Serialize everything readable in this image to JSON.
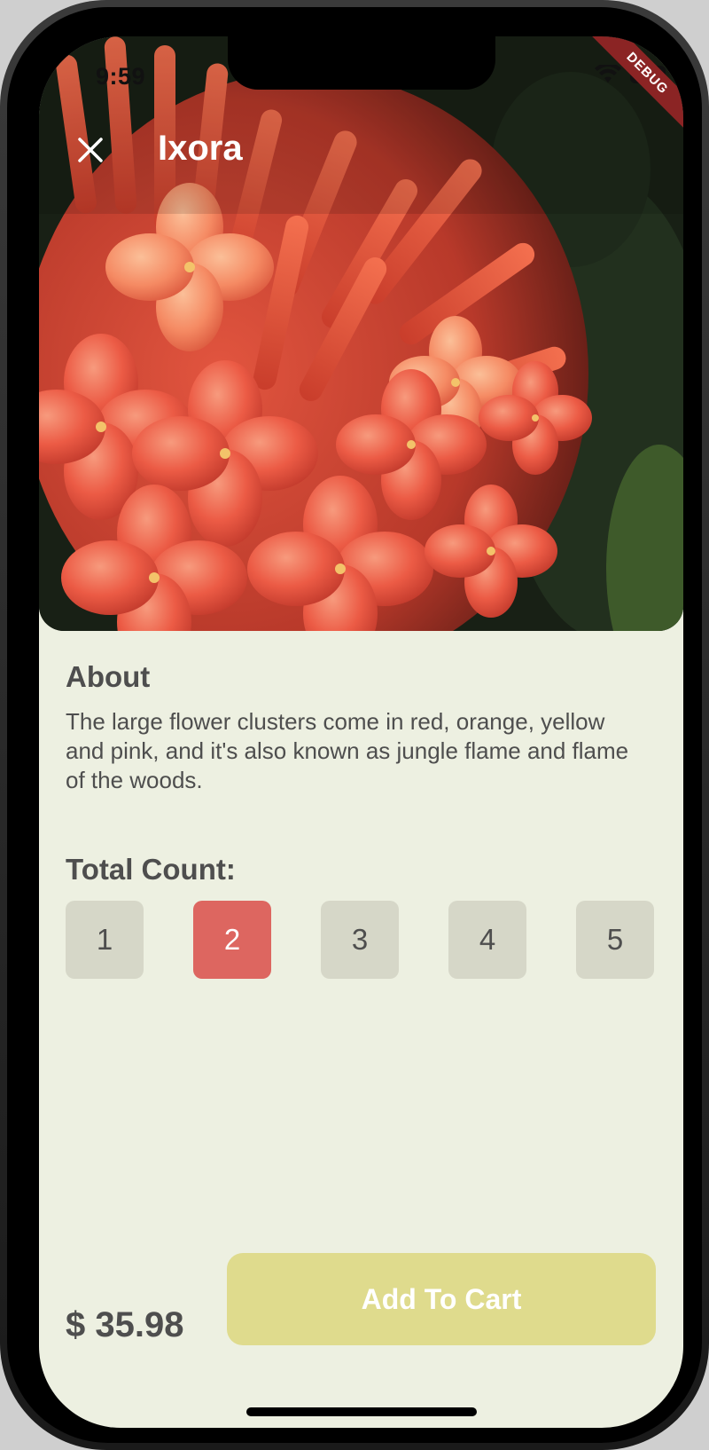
{
  "status_bar": {
    "time": "9:59",
    "debug_banner": "DEBUG",
    "icons": [
      "wifi-icon",
      "battery-icon"
    ]
  },
  "header": {
    "title": "Ixora",
    "close_icon": "close-icon"
  },
  "about": {
    "heading": "About",
    "text": "The large flower clusters come in red, orange, yellow and pink, and it's also known as jungle flame and flame of the woods."
  },
  "count": {
    "heading": "Total Count:",
    "options": [
      "1",
      "2",
      "3",
      "4",
      "5"
    ],
    "selected": "2"
  },
  "footer": {
    "price": "$ 35.98",
    "add_to_cart_label": "Add To Cart"
  },
  "colors": {
    "background": "#edf0e1",
    "text": "#4e4e4e",
    "selected_count": "#dd6660",
    "count_button": "#d6d7c8",
    "cart_button": "#dfdb8d"
  }
}
